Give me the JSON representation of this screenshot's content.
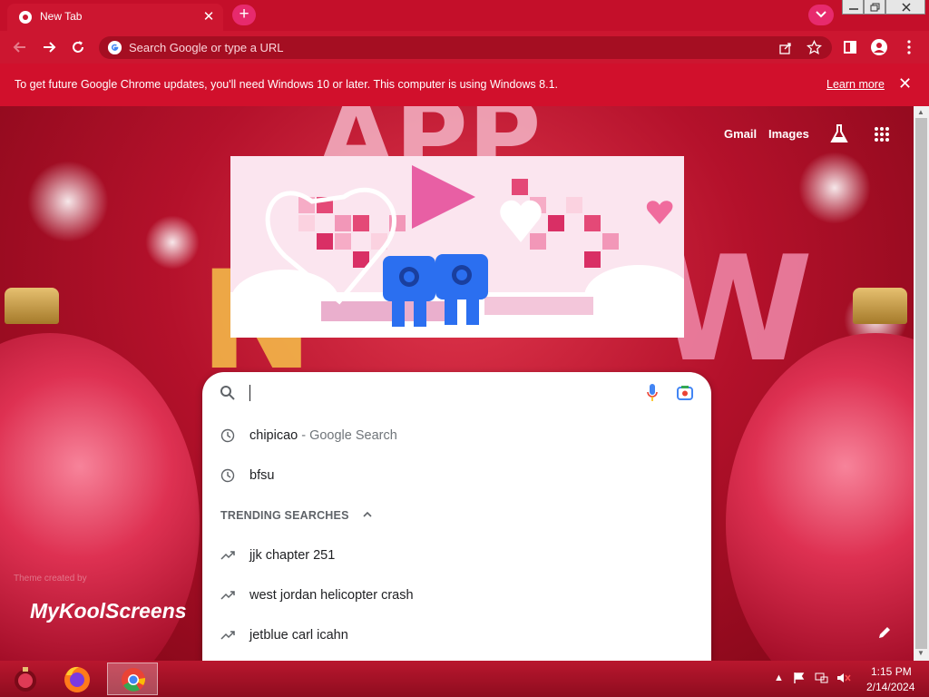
{
  "tab": {
    "title": "New Tab"
  },
  "toolbar": {
    "omnibox_placeholder": "Search Google or type a URL"
  },
  "infobar": {
    "message": "To get future Google Chrome updates, you'll need Windows 10 or later. This computer is using Windows 8.1.",
    "learn_more": "Learn more"
  },
  "ntp": {
    "gmail": "Gmail",
    "images": "Images",
    "search_input_value": "",
    "suggestions": [
      {
        "text": "chipicao",
        "suffix": " - Google Search",
        "icon": "history-icon"
      },
      {
        "text": "bfsu",
        "suffix": "",
        "icon": "history-icon"
      }
    ],
    "trending_header": "TRENDING SEARCHES",
    "trending": [
      {
        "text": "jjk chapter 251",
        "icon": "trending-icon"
      },
      {
        "text": "west jordan helicopter crash",
        "icon": "trending-icon"
      },
      {
        "text": "jetblue carl icahn",
        "icon": "trending-icon"
      }
    ],
    "theme_credit": "Theme created by",
    "theme_brand": "MyKoolScreens"
  },
  "taskbar": {
    "time": "1:15 PM",
    "date": "2/14/2024"
  },
  "colors": {
    "tabstrip": "#c40f2a",
    "toolbar": "#cc1630",
    "infobar": "#d1102c",
    "accent_pink": "#e72a6d"
  }
}
